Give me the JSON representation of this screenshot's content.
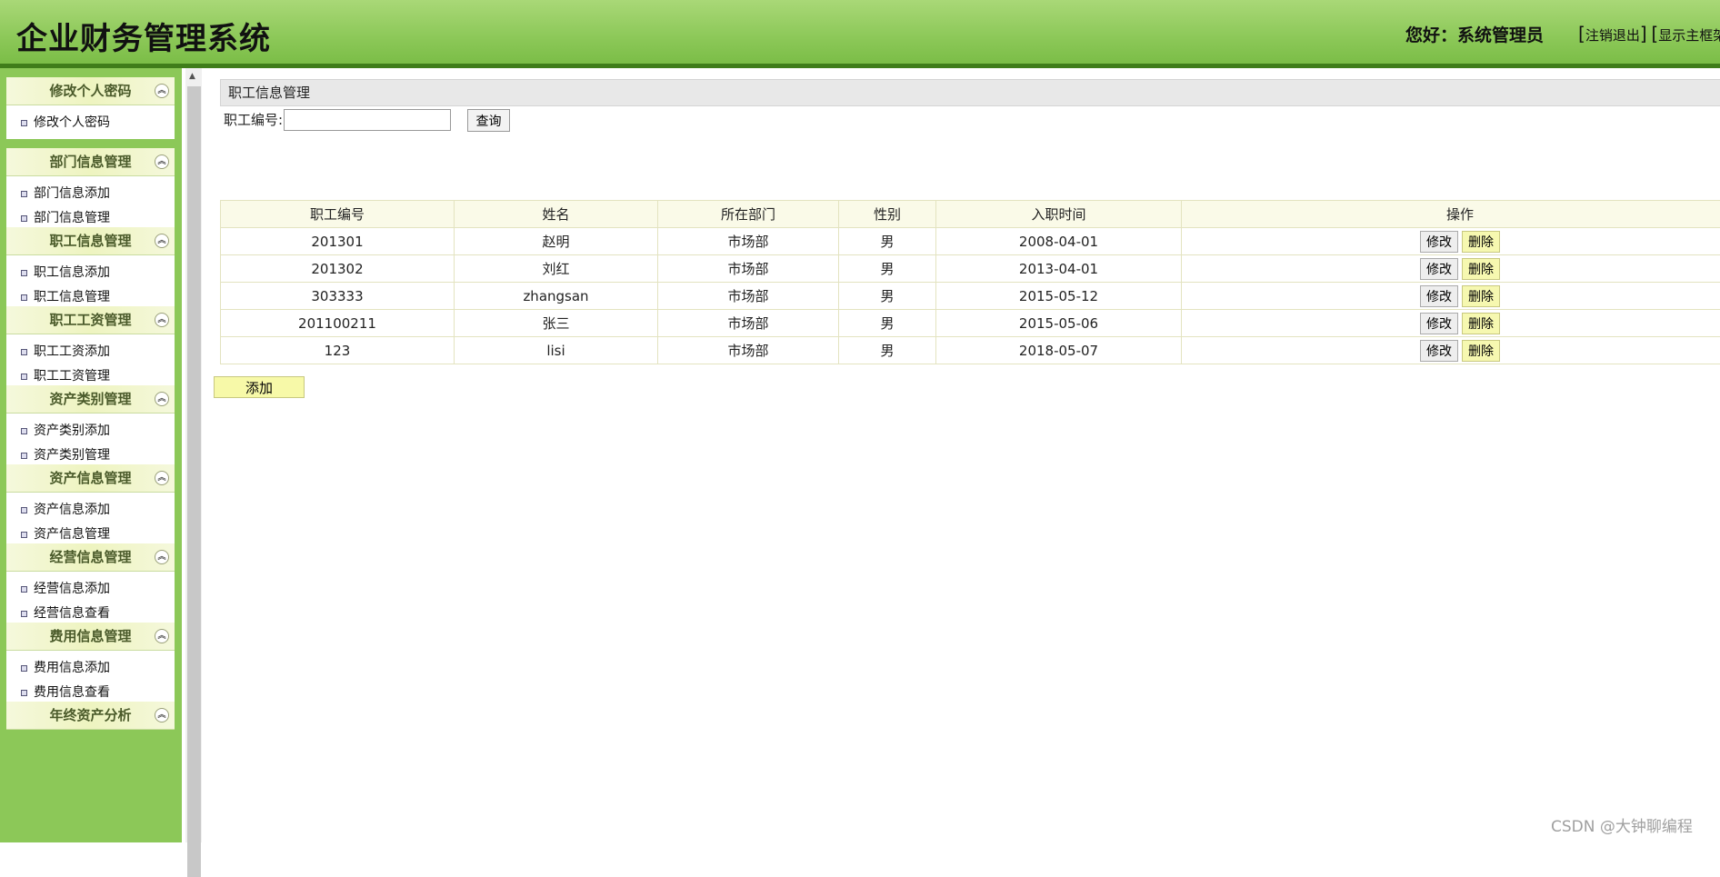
{
  "header": {
    "title": "企业财务管理系统",
    "greeting": "您好：系统管理员",
    "logout": "注销退出",
    "toggle_frame": "显示主框架"
  },
  "sidebar": {
    "groups": [
      {
        "title": "修改个人密码",
        "items": [
          "修改个人密码"
        ]
      },
      {
        "title": "部门信息管理",
        "items": [
          "部门信息添加",
          "部门信息管理"
        ]
      },
      {
        "title": "职工信息管理",
        "items": [
          "职工信息添加",
          "职工信息管理"
        ]
      },
      {
        "title": "职工工资管理",
        "items": [
          "职工工资添加",
          "职工工资管理"
        ]
      },
      {
        "title": "资产类别管理",
        "items": [
          "资产类别添加",
          "资产类别管理"
        ]
      },
      {
        "title": "资产信息管理",
        "items": [
          "资产信息添加",
          "资产信息管理"
        ]
      },
      {
        "title": "经营信息管理",
        "items": [
          "经营信息添加",
          "经营信息查看"
        ]
      },
      {
        "title": "费用信息管理",
        "items": [
          "费用信息添加",
          "费用信息查看"
        ]
      },
      {
        "title": "年终资产分析",
        "items": []
      }
    ]
  },
  "main": {
    "panel_title": "职工信息管理",
    "search": {
      "label": "职工编号:",
      "value": "",
      "button": "查询"
    },
    "table": {
      "headers": [
        "职工编号",
        "姓名",
        "所在部门",
        "性别",
        "入职时间",
        "操作"
      ],
      "rows": [
        [
          "201301",
          "赵明",
          "市场部",
          "男",
          "2008-04-01"
        ],
        [
          "201302",
          "刘红",
          "市场部",
          "男",
          "2013-04-01"
        ],
        [
          "303333",
          "zhangsan",
          "市场部",
          "男",
          "2015-05-12"
        ],
        [
          "201100211",
          "张三",
          "市场部",
          "男",
          "2015-05-06"
        ],
        [
          "123",
          "lisi",
          "市场部",
          "男",
          "2018-05-07"
        ]
      ],
      "edit_label": "修改",
      "delete_label": "删除"
    },
    "add_button": "添加"
  },
  "watermark": "CSDN @大钟聊编程"
}
